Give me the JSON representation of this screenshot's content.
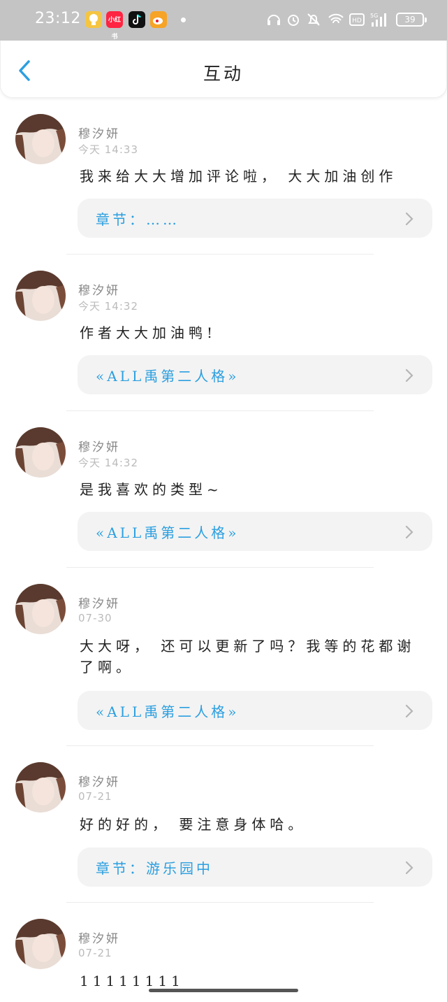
{
  "status_bar": {
    "time": "23:12",
    "apps": [
      {
        "icon": "bulb-app-icon",
        "label": "",
        "color": "#f5c542"
      },
      {
        "icon": "xiaohongshu-app-icon",
        "label": "小红书",
        "color": "#ff2442"
      },
      {
        "icon": "tiktok-app-icon",
        "label": "",
        "color": "#111111"
      },
      {
        "icon": "weibo-app-icon",
        "label": "",
        "color": "#f7a325"
      }
    ],
    "battery": "39"
  },
  "header": {
    "title": "互动",
    "back_icon": "back-chevron-icon",
    "accent": "#2b9fe0"
  },
  "comments": [
    {
      "user": "穆汐妍",
      "time": "今天 14:33",
      "content": "我来给大大增加评论啦， 大大加油创作",
      "link": "章节：……"
    },
    {
      "user": "穆汐妍",
      "time": "今天 14:32",
      "content": "作者大大加油鸭!",
      "link": "«ALL禹第二人格»"
    },
    {
      "user": "穆汐妍",
      "time": "今天 14:32",
      "content": "是我喜欢的类型~",
      "link": "«ALL禹第二人格»"
    },
    {
      "user": "穆汐妍",
      "time": "07-30",
      "content": "大大呀， 还可以更新了吗？我等的花都谢了啊。",
      "link": "«ALL禹第二人格»"
    },
    {
      "user": "穆汐妍",
      "time": "07-21",
      "content": "好的好的， 要注意身体哈。",
      "link": "章节：游乐园中"
    },
    {
      "user": "穆汐妍",
      "time": "07-21",
      "content": "11111111",
      "link": ""
    }
  ]
}
